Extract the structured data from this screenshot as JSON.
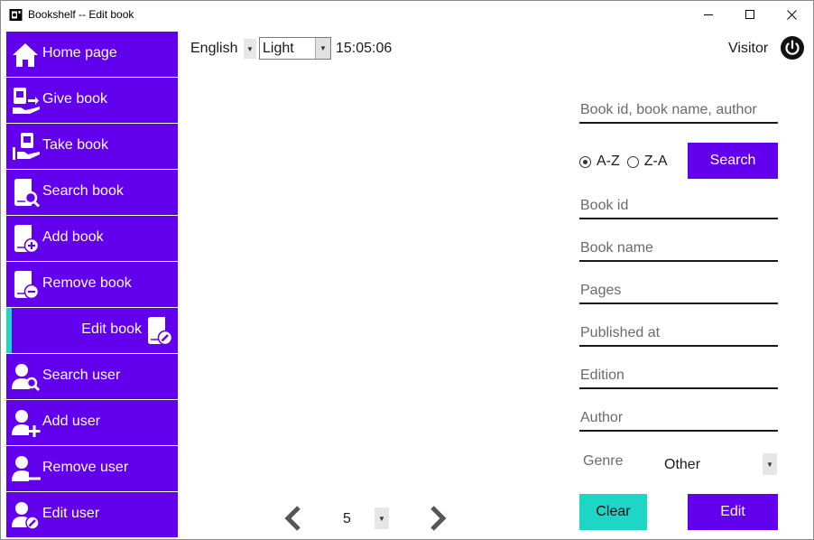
{
  "window": {
    "title": "Bookshelf -- Edit book",
    "controls": [
      "minimize",
      "maximize",
      "close"
    ]
  },
  "colors": {
    "accent": "#6200ee",
    "secondary": "#1dd6c5",
    "text": "#1a1a1a",
    "placeholder": "#6b6b6b"
  },
  "sidebar": {
    "items": [
      {
        "label": "Home page",
        "icon": "home-icon"
      },
      {
        "label": "Give book",
        "icon": "give-book-icon"
      },
      {
        "label": "Take book",
        "icon": "take-book-icon"
      },
      {
        "label": "Search book",
        "icon": "search-book-icon"
      },
      {
        "label": "Add book",
        "icon": "add-book-icon"
      },
      {
        "label": "Remove book",
        "icon": "remove-book-icon"
      },
      {
        "label": "Edit book",
        "icon": "edit-book-icon",
        "active": true
      },
      {
        "label": "Search user",
        "icon": "search-user-icon"
      },
      {
        "label": "Add user",
        "icon": "add-user-icon"
      },
      {
        "label": "Remove user",
        "icon": "remove-user-icon"
      },
      {
        "label": "Edit user",
        "icon": "edit-user-icon"
      }
    ]
  },
  "topbar": {
    "language": "English",
    "theme": "Light",
    "clock": "15:05:06",
    "user": "Visitor"
  },
  "form": {
    "search_placeholder": "Book id, book name, author",
    "sort_asc": "A-Z",
    "sort_desc": "Z-A",
    "sort_selected": "A-Z",
    "search_button": "Search",
    "book_id_placeholder": "Book id",
    "book_name_placeholder": "Book name",
    "pages_placeholder": "Pages",
    "published_placeholder": "Published at",
    "edition_placeholder": "Edition",
    "author_placeholder": "Author",
    "genre_label": "Genre",
    "genre_value": "Other",
    "clear_button": "Clear",
    "edit_button": "Edit"
  },
  "pagination": {
    "page": "5"
  }
}
